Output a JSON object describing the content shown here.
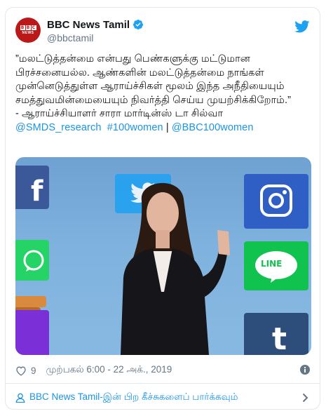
{
  "tweet": {
    "author": {
      "display_name": "BBC News Tamil",
      "handle": "@bbctamil",
      "avatar_logo_text": "BBC NEWS",
      "verified": true
    },
    "text_lines": [
      "”மலட்டுத்தன்மை என்பது பெண்களுக்கு மட்டுமான",
      "பிரச்சனையல்ல. ஆண்களின் மலட்டுத்தன்மை நாங்கள்",
      "முன்னெடுத்துள்ள ஆராய்ச்சிகள் மூலம் இந்த அநீதியையும்",
      "சமத்துவமின்மையையும் நிவர்த்தி செய்ய முயற்சிக்கிறோம்.”",
      "- ஆராய்ச்சியாளர் சாரா மார்டின்ஸ் டா சில்வா"
    ],
    "links": {
      "mention1": "@SMDS_research",
      "hashtag": "#100women",
      "separator": "|",
      "mention2": "@BBC100women"
    },
    "media": {
      "tile_glyphs": {
        "facebook": "f",
        "line": "LINE",
        "tumblr": "t"
      }
    },
    "likes": "9",
    "timestamp": "முற்பகல் 6:00 - 22 அக்., 2019",
    "see_more": "BBC News Tamil-இன் பிற கீச்சுகளைப் பார்க்கவும்"
  },
  "icons": {
    "verified": "verified-badge-icon",
    "twitter": "twitter-bird-icon",
    "heart": "heart-icon",
    "info": "info-icon",
    "user": "user-icon",
    "chevron": "chevron-right-icon"
  },
  "colors": {
    "link": "#1b95e0",
    "bbc_red": "#bb1919",
    "twitter_blue": "#1da1f2",
    "secondary_text": "#657786"
  }
}
